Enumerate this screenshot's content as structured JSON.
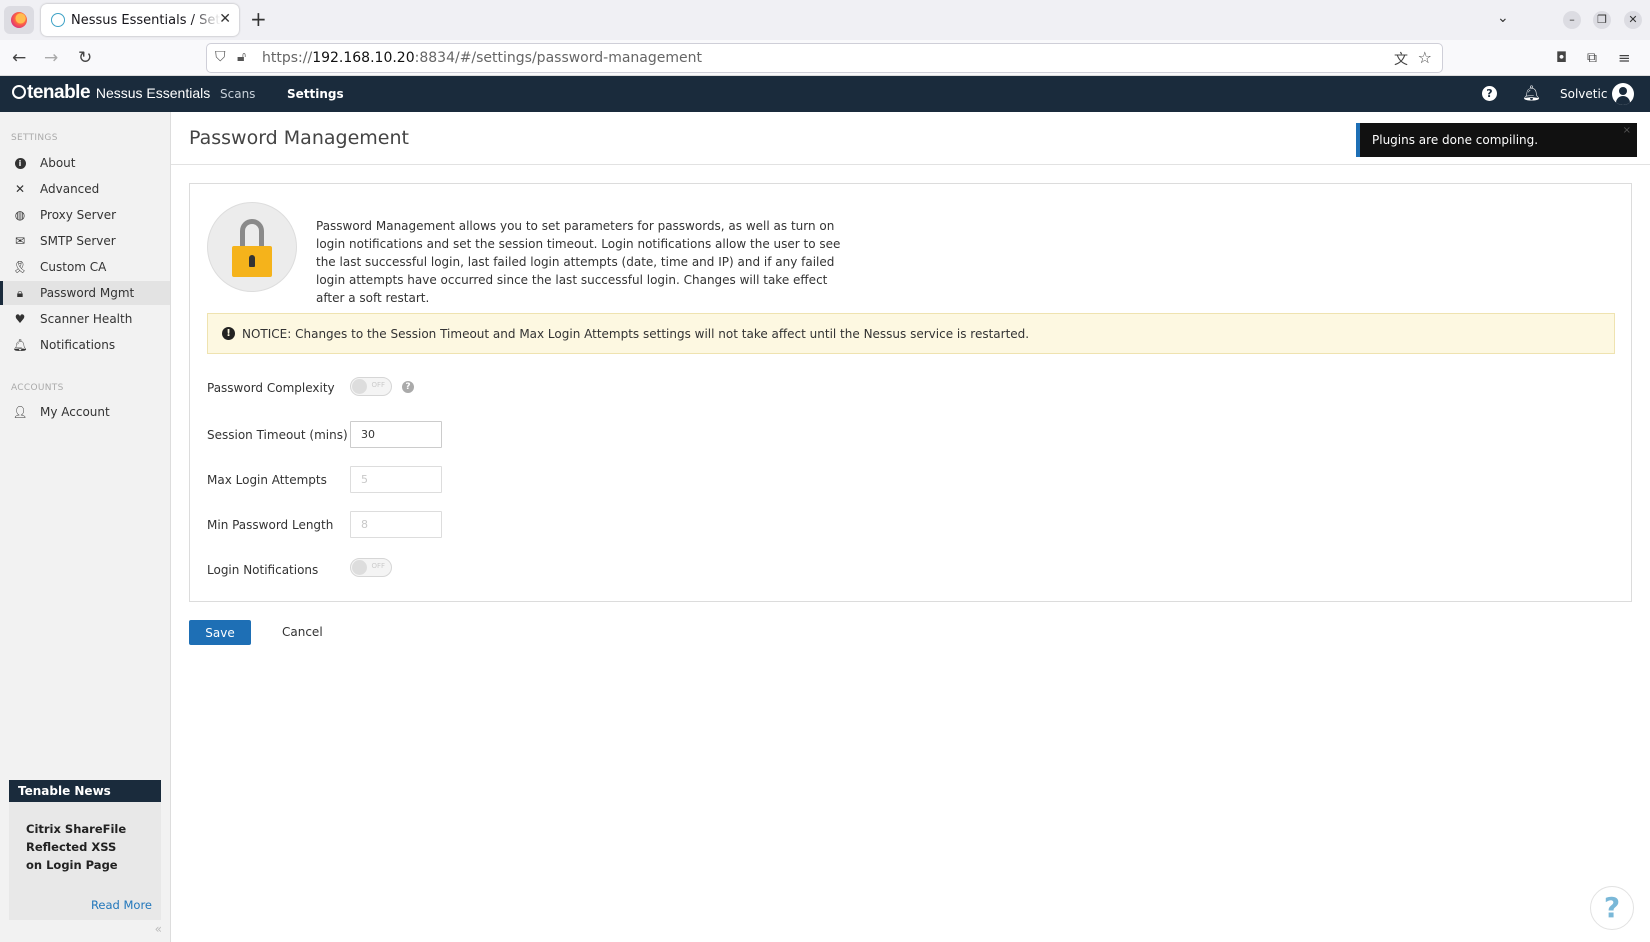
{
  "browser": {
    "tab_title": "Nessus Essentials / Settings",
    "url_prefix": "https://",
    "url_host": "192.168.10.20",
    "url_rest": ":8834/#/settings/password-management"
  },
  "header": {
    "brand_name": "tenable",
    "brand_product": "Nessus Essentials",
    "nav": [
      {
        "label": "Scans",
        "active": false
      },
      {
        "label": "Settings",
        "active": true
      }
    ],
    "username": "Solvetic"
  },
  "sidebar": {
    "settings_heading": "SETTINGS",
    "items": [
      {
        "label": "About",
        "icon": "info-icon"
      },
      {
        "label": "Advanced",
        "icon": "tools-icon"
      },
      {
        "label": "Proxy Server",
        "icon": "globe-icon"
      },
      {
        "label": "SMTP Server",
        "icon": "envelope-icon"
      },
      {
        "label": "Custom CA",
        "icon": "ribbon-icon"
      },
      {
        "label": "Password Mgmt",
        "icon": "lock-icon",
        "active": true
      },
      {
        "label": "Scanner Health",
        "icon": "heartbeat-icon"
      },
      {
        "label": "Notifications",
        "icon": "bell-icon"
      }
    ],
    "accounts_heading": "ACCOUNTS",
    "account_items": [
      {
        "label": "My Account",
        "icon": "user-icon"
      }
    ],
    "news": {
      "title": "Tenable News",
      "headline": "Citrix ShareFile Reflected XSS on Login Page",
      "read_more": "Read More"
    },
    "collapse_label": "«"
  },
  "main": {
    "title": "Password Management",
    "intro": "Password Management allows you to set parameters for passwords, as well as turn on login notifications and set the session timeout. Login notifications allow the user to see the last successful login, last failed login attempts (date, time and IP) and if any failed login attempts have occurred since the last successful login. Changes will take effect after a soft restart.",
    "notice": "NOTICE: Changes to the Session Timeout and Max Login Attempts settings will not take affect until the Nessus service is restarted.",
    "fields": {
      "password_complexity": {
        "label": "Password Complexity",
        "state": "OFF"
      },
      "session_timeout": {
        "label": "Session Timeout (mins)",
        "value": "30"
      },
      "max_login_attempts": {
        "label": "Max Login Attempts",
        "placeholder": "5"
      },
      "min_password_length": {
        "label": "Min Password Length",
        "placeholder": "8"
      },
      "login_notifications": {
        "label": "Login Notifications",
        "state": "OFF"
      }
    },
    "save_label": "Save",
    "cancel_label": "Cancel"
  },
  "toast": {
    "message": "Plugins are done compiling.",
    "close": "×"
  },
  "colors": {
    "header_bg": "#1a2b3c",
    "primary_button": "#1e6fb5",
    "notice_bg": "#fdf8e1",
    "lock_body": "#f5b31b"
  }
}
